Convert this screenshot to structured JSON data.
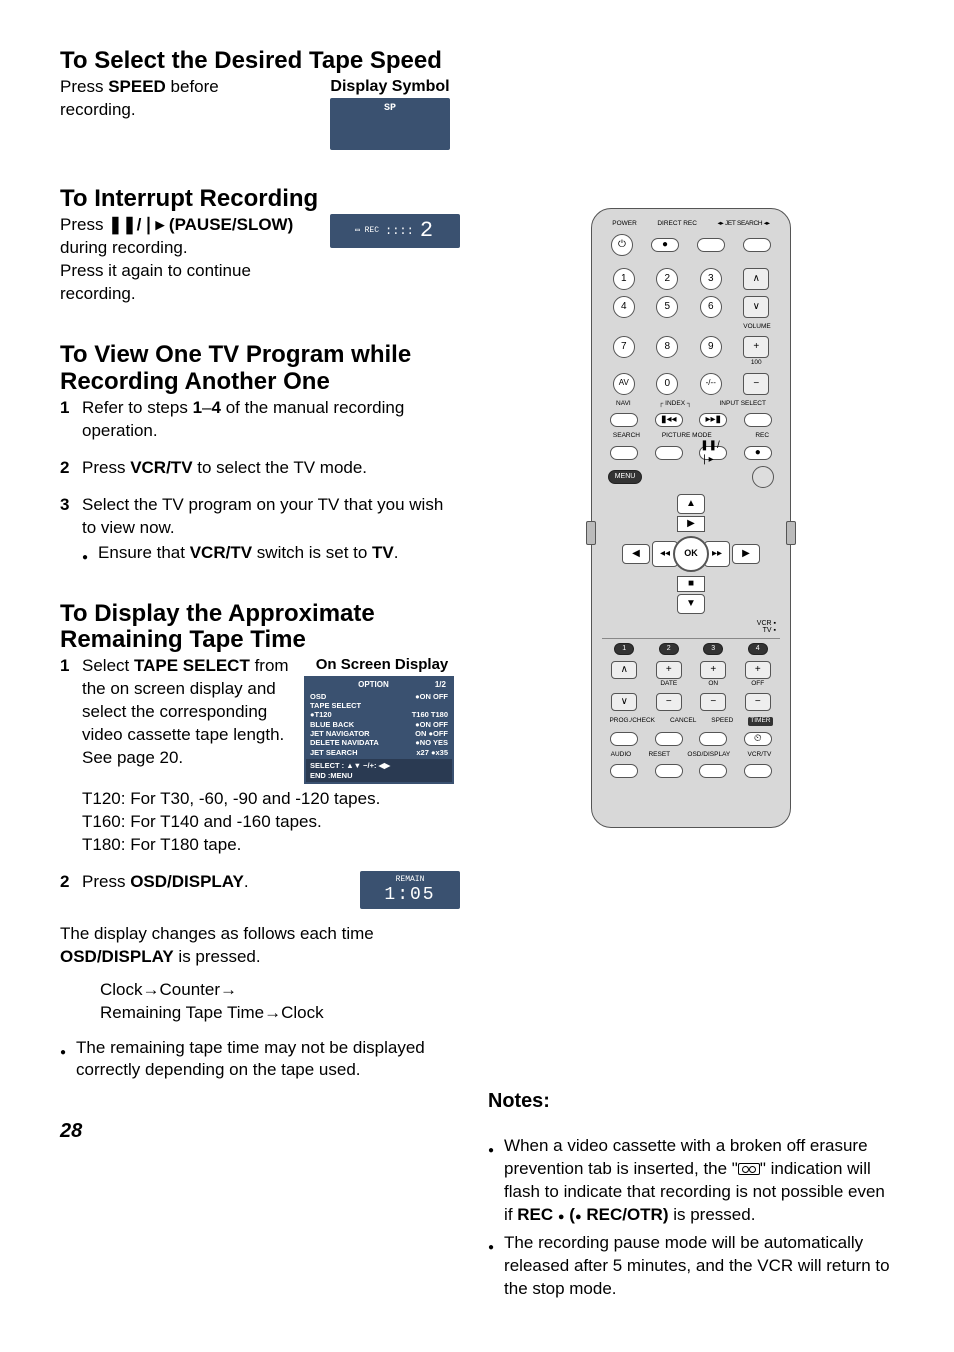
{
  "page_number": "28",
  "sections": {
    "speed": {
      "heading": "To Select the Desired Tape Speed",
      "body_pre": "Press ",
      "body_bold": "SPEED",
      "body_post": " before recording.",
      "disp_label": "Display Symbol",
      "disp_text": "SP"
    },
    "interrupt": {
      "heading": "To Interrupt Recording",
      "line1_pre": "Press ",
      "line1_icon": "❚❚/❘▸",
      "line1_bold": " (PAUSE/SLOW)",
      "line2": "during recording.",
      "line3": "Press it again to continue recording.",
      "disp_icons": "▭ REC",
      "disp_seg": "2"
    },
    "view": {
      "heading": "To View One TV Program while Recording Another One",
      "steps": [
        {
          "n": "1",
          "pre": "Refer to steps ",
          "b1": "1",
          "mid": "–",
          "b2": "4",
          "post": " of the manual recording operation."
        },
        {
          "n": "2",
          "pre": "Press ",
          "b1": "VCR/TV",
          "post": " to select the TV mode."
        },
        {
          "n": "3",
          "pre": "Select the TV program on your TV that you wish to view now.",
          "post": ""
        }
      ],
      "step3_bullet_pre": "Ensure that ",
      "step3_bullet_b1": "VCR/TV",
      "step3_bullet_mid": " switch is set to ",
      "step3_bullet_b2": "TV",
      "step3_bullet_post": "."
    },
    "remain": {
      "heading": "To Display the Approximate Remaining Tape Time",
      "step1_pre": "Select ",
      "step1_bold": "TAPE SELECT",
      "step1_post": " from the on screen display and select the corresponding video cassette tape length. See page 20.",
      "osd_label": "On Screen Display",
      "tape_lines": [
        "T120:  For T30, -60, -90 and -120 tapes.",
        "T160:  For T140 and -160 tapes.",
        "T180:  For T180 tape."
      ],
      "step2_pre": "Press ",
      "step2_bold": "OSD/DISPLAY",
      "step2_post": ".",
      "remain_tiny": "REMAIN",
      "remain_seg": "1:05",
      "cycle_pre": "The display changes as follows each time ",
      "cycle_bold": "OSD/DISPLAY",
      "cycle_post": " is pressed.",
      "cycle_line1": "Clock→Counter→",
      "cycle_line2": "Remaining Tape Time→Clock",
      "bullet_tail": "The remaining tape time may not be displayed correctly depending on the tape used."
    }
  },
  "osd_panel": {
    "title": "OPTION",
    "page": "1/2",
    "rows": [
      {
        "l": "OSD",
        "r": "●ON   OFF"
      },
      {
        "l": "TAPE SELECT",
        "r": ""
      },
      {
        "l": "        ●T120",
        "r": "T160   T180"
      },
      {
        "l": "BLUE BACK",
        "r": "●ON   OFF"
      },
      {
        "l": "JET NAVIGATOR",
        "r": "ON  ●OFF"
      },
      {
        "l": "DELETE NAVIDATA",
        "r": "●NO   YES"
      },
      {
        "l": "JET SEARCH",
        "r": "x27   ●x35"
      }
    ],
    "foot1": "SELECT  : ▲▼    −/+: ◀▶",
    "foot2": "END        :MENU"
  },
  "notes": {
    "heading": "Notes:",
    "n1_pre": "When a video cassette with a broken off erasure prevention tab is inserted, the \"",
    "n1_post": "\" indication will flash to indicate that recording is not possible even if ",
    "n1_b1": "REC ",
    "n1_b2": " (",
    "n1_b3": " REC/OTR)",
    "n1_tail": " is pressed.",
    "n2": "The recording pause mode will be automatically released after 5 minutes, and the VCR will return to the stop mode."
  },
  "remote": {
    "top_labels": [
      "POWER",
      "DIRECT REC",
      "JET SEARCH"
    ],
    "num": [
      "1",
      "2",
      "3",
      "4",
      "5",
      "6",
      "7",
      "8",
      "9",
      "AV",
      "0",
      "-/--"
    ],
    "volume": "VOLUME",
    "hundred": "100",
    "mid_labels": [
      "NAVI",
      "INDEX",
      "INPUT SELECT"
    ],
    "mid2": [
      "SEARCH",
      "PICTURE MODE",
      "REC"
    ],
    "menu": "MENU",
    "ok": "OK",
    "vcr_tv": "VCR\nTV",
    "row_small": [
      "1",
      "2",
      "3",
      "4"
    ],
    "row_date": [
      "",
      "DATE",
      "ON",
      "OFF"
    ],
    "row_plus": [
      "+",
      "+",
      "+",
      "+"
    ],
    "row_minus": [
      "−",
      "−",
      "−",
      "−"
    ],
    "row_bottom1": [
      "PROG./CHECK",
      "CANCEL",
      "SPEED",
      "TIMER"
    ],
    "row_bottom2": [
      "AUDIO",
      "RESET",
      "OSD/DISPLAY",
      "VCR/TV"
    ]
  }
}
